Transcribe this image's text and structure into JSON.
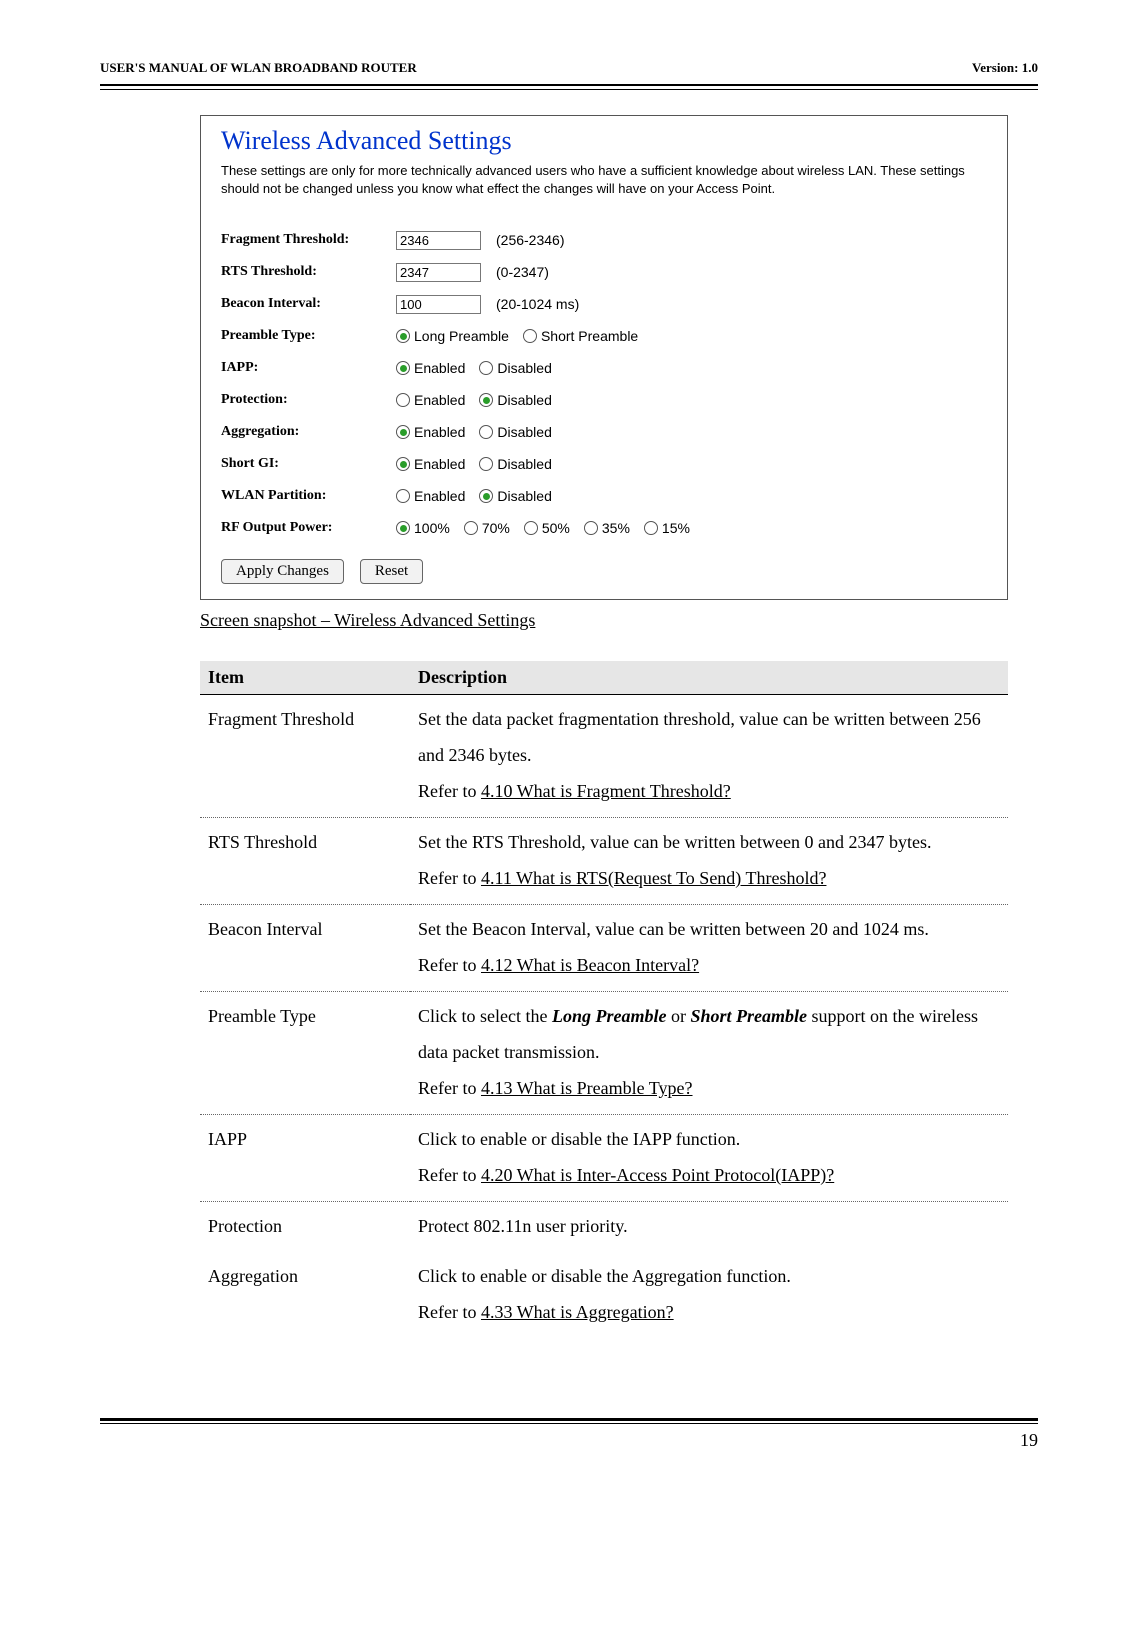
{
  "header": {
    "left": "USER'S MANUAL OF WLAN BROADBAND ROUTER",
    "right": "Version: 1.0"
  },
  "panel": {
    "title": "Wireless Advanced Settings",
    "desc": "These settings are only for more technically advanced users who have a sufficient knowledge about wireless LAN. These settings should not be changed unless you know what effect the changes will have on your Access Point.",
    "fragmentLabel": "Fragment Threshold:",
    "fragmentVal": "2346",
    "fragmentRange": "(256-2346)",
    "rtsLabel": "RTS Threshold:",
    "rtsVal": "2347",
    "rtsRange": "(0-2347)",
    "beaconLabel": "Beacon Interval:",
    "beaconVal": "100",
    "beaconRange": "(20-1024 ms)",
    "preambleLabel": "Preamble Type:",
    "preambleLong": "Long Preamble",
    "preambleShort": "Short Preamble",
    "iappLabel": "IAPP:",
    "protectionLabel": "Protection:",
    "aggregationLabel": "Aggregation:",
    "shortgiLabel": "Short GI:",
    "wlanpartLabel": "WLAN Partition:",
    "rfoutLabel": "RF Output Power:",
    "enabled": "Enabled",
    "disabled": "Disabled",
    "p100": "100%",
    "p70": "70%",
    "p50": "50%",
    "p35": "35%",
    "p15": "15%",
    "applyBtn": "Apply Changes",
    "resetBtn": "Reset"
  },
  "caption": "Screen snapshot – Wireless Advanced Settings",
  "table": {
    "hItem": "Item",
    "hDesc": "Description",
    "rows": [
      {
        "item": "Fragment Threshold",
        "l1": "Set the data packet fragmentation threshold, value can be written between 256 and 2346 bytes.",
        "ref": "4.10 What is Fragment Threshold?"
      },
      {
        "item": "RTS Threshold",
        "l1": "Set the RTS Threshold, value can be written between 0 and 2347 bytes.",
        "ref": "4.11 What is RTS(Request To Send) Threshold?"
      },
      {
        "item": "Beacon Interval",
        "l1": "Set the Beacon Interval, value can be written between 20 and 1024 ms.",
        "ref": "4.12 What is Beacon Interval?"
      },
      {
        "item": "Preamble Type",
        "pre1": "Click to select the ",
        "em1": "Long Preamble",
        "mid": " or ",
        "em2": "Short Preamble",
        "post": " support on the wireless data packet transmission.",
        "ref": "4.13 What is Preamble Type?"
      },
      {
        "item": "IAPP",
        "l1": "Click to enable or disable the IAPP function.",
        "ref": "4.20 What is Inter-Access Point Protocol(IAPP)?"
      },
      {
        "item": "Protection",
        "l1": "Protect 802.11n user priority."
      },
      {
        "item": "Aggregation",
        "l1": "Click to enable or disable the Aggregation function.",
        "ref": "4.33 What is Aggregation?"
      }
    ]
  },
  "referPrefix": "Refer to ",
  "pageNum": "19"
}
